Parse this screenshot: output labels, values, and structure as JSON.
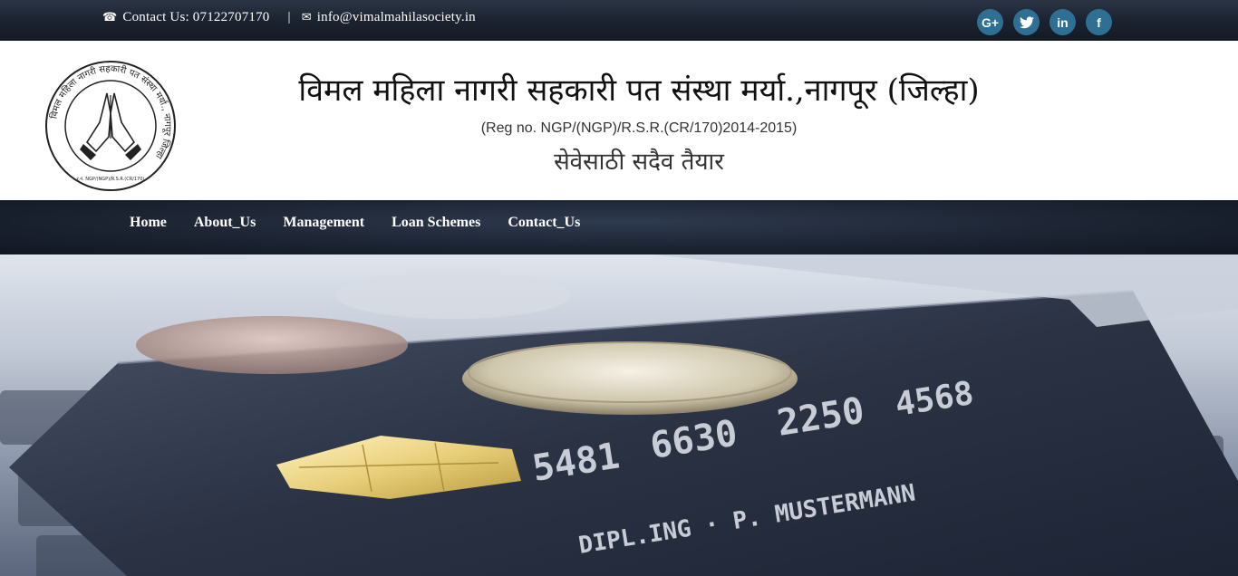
{
  "topbar": {
    "contact_label": "Contact Us: 07122707170",
    "separator": "|",
    "email": "info@vimalmahilasociety.in",
    "social": [
      {
        "icon": "google-plus-icon",
        "glyph": "G+"
      },
      {
        "icon": "twitter-icon",
        "glyph": "t"
      },
      {
        "icon": "linkedin-icon",
        "glyph": "in"
      },
      {
        "icon": "facebook-icon",
        "glyph": "f"
      }
    ]
  },
  "header": {
    "title": "विमल महिला नागरी सहकारी पत संस्था मर्या.,नागपूर (जिल्हा)",
    "reg": "(Reg no. NGP/(NGP)/R.S.R.(CR/170)2014-2015)",
    "tagline": "सेवेसाठी सदैव तैयार",
    "logo_ring_text": "विमल महिला नागरी सहकारी पत संस्था मर्या., नागपूर जिल्हा",
    "logo_bottom_text": "र.नं. NGP/(NGP)/R.S.R.(CR/170)"
  },
  "nav": {
    "items": [
      "Home",
      "About_Us",
      "Management",
      "Loan Schemes",
      "Contact_Us"
    ]
  },
  "colors": {
    "topbar_bg": "#1c2330",
    "social_bg": "#2f6f93",
    "nav_bg": "#1b2230"
  }
}
